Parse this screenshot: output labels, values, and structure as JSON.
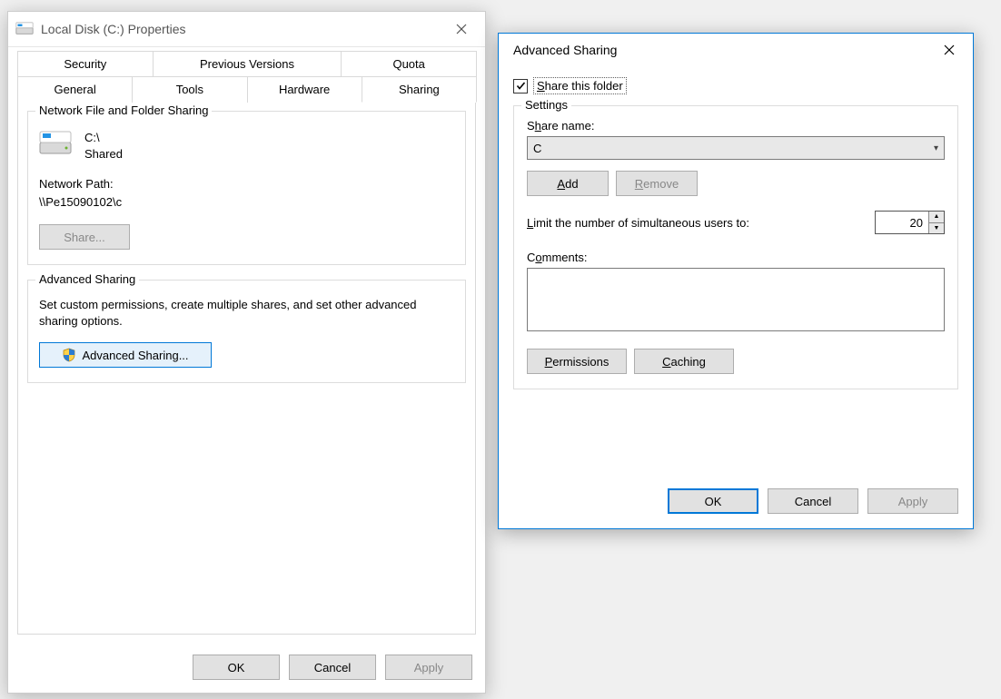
{
  "props": {
    "title": "Local Disk (C:) Properties",
    "tabs_row1": [
      "Security",
      "Previous Versions",
      "Quota"
    ],
    "tabs_row2": [
      "General",
      "Tools",
      "Hardware",
      "Sharing"
    ],
    "active_tab": "Sharing",
    "network_group_title": "Network File and Folder Sharing",
    "drive_name": "C:\\",
    "drive_status": "Shared",
    "network_path_label": "Network Path:",
    "network_path_value": "\\\\Pe15090102\\c",
    "share_button": "Share...",
    "advanced_group_title": "Advanced Sharing",
    "advanced_desc": "Set custom permissions, create multiple shares, and set other advanced sharing options.",
    "advanced_button": "Advanced Sharing...",
    "buttons": {
      "ok": "OK",
      "cancel": "Cancel",
      "apply": "Apply"
    }
  },
  "adv": {
    "title": "Advanced Sharing",
    "checkbox_label": "Share this folder",
    "checkbox_checked": true,
    "settings_title": "Settings",
    "share_name_label": "Share name:",
    "share_name_value": "C",
    "add_button": "Add",
    "remove_button": "Remove",
    "limit_label": "Limit the number of simultaneous users to:",
    "limit_value": "20",
    "comments_label": "Comments:",
    "comments_value": "",
    "permissions_button": "Permissions",
    "caching_button": "Caching",
    "buttons": {
      "ok": "OK",
      "cancel": "Cancel",
      "apply": "Apply"
    }
  }
}
